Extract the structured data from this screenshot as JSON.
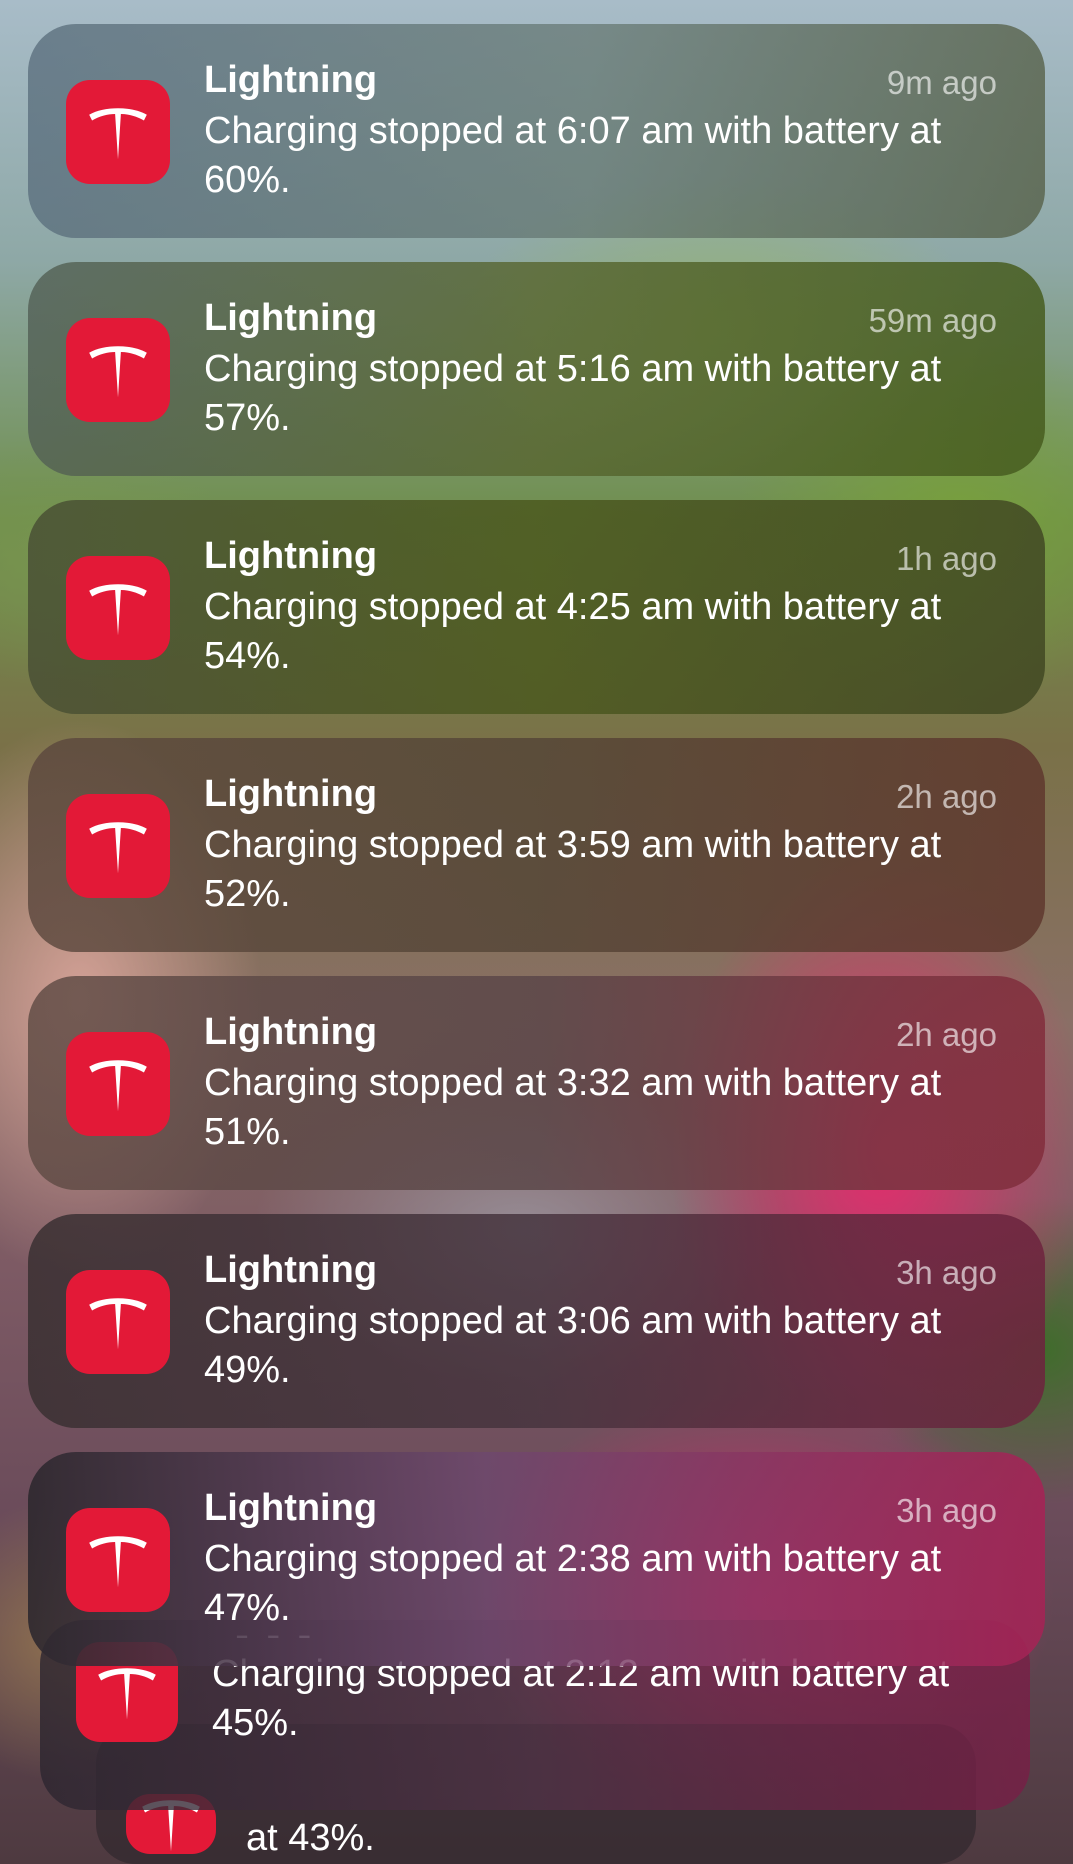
{
  "notifications": [
    {
      "app": "Lightning",
      "time": "9m ago",
      "message": "Charging stopped at 6:07 am with battery at 60%.",
      "icon": "tesla-logo-icon"
    },
    {
      "app": "Lightning",
      "time": "59m ago",
      "message": "Charging stopped at 5:16 am with battery at 57%.",
      "icon": "tesla-logo-icon"
    },
    {
      "app": "Lightning",
      "time": "1h ago",
      "message": "Charging stopped at 4:25 am with battery at 54%.",
      "icon": "tesla-logo-icon"
    },
    {
      "app": "Lightning",
      "time": "2h ago",
      "message": "Charging stopped at 3:59 am with battery at 52%.",
      "icon": "tesla-logo-icon"
    },
    {
      "app": "Lightning",
      "time": "2h ago",
      "message": "Charging stopped at 3:32 am with battery at 51%.",
      "icon": "tesla-logo-icon"
    },
    {
      "app": "Lightning",
      "time": "3h ago",
      "message": "Charging stopped at 3:06 am with battery at 49%.",
      "icon": "tesla-logo-icon"
    },
    {
      "app": "Lightning",
      "time": "3h ago",
      "message": "Charging stopped at 2:38 am with battery at 47%.",
      "icon": "tesla-logo-icon"
    }
  ],
  "stacked": [
    {
      "message": "Charging stopped at 2:12 am with battery at 45%.",
      "icon": "tesla-logo-icon"
    },
    {
      "message": "at 43%.",
      "icon": "tesla-logo-icon"
    }
  ],
  "colors": {
    "icon_background": "#e31937",
    "text": "#ffffff"
  }
}
